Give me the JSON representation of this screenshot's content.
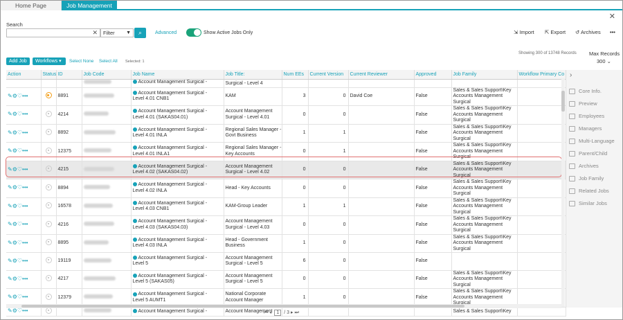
{
  "tabs": [
    {
      "label": "Home Page"
    },
    {
      "label": "Job Management"
    }
  ],
  "search": {
    "label": "Search",
    "value": "",
    "filter": "Filter",
    "advanced": "Advanced",
    "toggle_label": "Show Active Jobs Only"
  },
  "toolbar": {
    "import": "Import",
    "export": "Export",
    "archives": "Archives",
    "add_job": "Add Job",
    "workflows": "Workflows",
    "select_none": "Select None",
    "select_all": "Select All",
    "selected": "Selected: 1",
    "showing": "Showing 300 of 13748 Records",
    "max_records_label": "Max Records",
    "max_records_value": "300"
  },
  "columns": [
    "Action",
    "Status",
    "ID",
    "Job Code",
    "Job Name",
    "Job Title:",
    "Num EEs",
    "Current Version",
    "Current Reviewer",
    "Approved",
    "Job Family",
    "Workflow Primary Co"
  ],
  "top_partial": {
    "job_name": "Account Management Surgical -",
    "job_title": "Surgical - Level 4"
  },
  "rows": [
    {
      "id": "8891",
      "status": "orange",
      "name1": "Account Management Surgical -",
      "name2": "Level 4.01  CNB1",
      "title": "KAM",
      "ees": "3",
      "ver": "0",
      "reviewer": "David Coe",
      "approved": "False",
      "family": "Sales & Sales Support\\Key Accounts Management Surgical"
    },
    {
      "id": "4214",
      "status": "grey",
      "name1": "Account Management Surgical -",
      "name2": "Level 4.01 (SAKAS04.01)",
      "title": "Account Management Surgical - Level 4.01",
      "ees": "0",
      "ver": "0",
      "reviewer": "",
      "approved": "False",
      "family": "Sales & Sales Support\\Key Accounts Management Surgical"
    },
    {
      "id": "8892",
      "status": "grey",
      "name1": "Account Management Surgical -",
      "name2": "Level 4.01 INLA",
      "title": "Regional Sales Manager - Govt Business",
      "ees": "1",
      "ver": "1",
      "reviewer": "",
      "approved": "False",
      "family": "Sales & Sales Support\\Key Accounts Management Surgical"
    },
    {
      "id": "12375",
      "status": "grey",
      "name1": "Account Management Surgical -",
      "name2": "Level 4.01 INLA1",
      "title": "Regional Sales Manager - Key Accounts",
      "ees": "0",
      "ver": "1",
      "reviewer": "",
      "approved": "False",
      "family": "Sales & Sales Support\\Key Accounts Management Surgical"
    },
    {
      "id": "4215",
      "status": "grey",
      "name1": "Account Management Surgical -",
      "name2": "Level 4.02 (SAKAS04.02)",
      "title": "Account Management Surgical - Level 4.02",
      "ees": "0",
      "ver": "0",
      "reviewer": "",
      "approved": "False",
      "family": "Sales & Sales Support\\Key Accounts Management Surgical"
    },
    {
      "id": "8894",
      "status": "grey",
      "name1": "Account Management Surgical -",
      "name2": "Level 4.02 INLA",
      "title": "Head - Key Accounts",
      "ees": "0",
      "ver": "0",
      "reviewer": "",
      "approved": "False",
      "family": "Sales & Sales Support\\Key Accounts Management Surgical"
    },
    {
      "id": "16578",
      "status": "grey",
      "name1": "Account Management Surgical -",
      "name2": "Level 4.03  CNB1",
      "title": "KAM-Group Leader",
      "ees": "1",
      "ver": "1",
      "reviewer": "",
      "approved": "False",
      "family": "Sales & Sales Support\\Key Accounts Management Surgical"
    },
    {
      "id": "4216",
      "status": "grey",
      "name1": "Account Management Surgical -",
      "name2": "Level 4.03 (SAKAS04.03)",
      "title": "Account Management Surgical - Level 4.03",
      "ees": "0",
      "ver": "0",
      "reviewer": "",
      "approved": "False",
      "family": "Sales & Sales Support\\Key Accounts Management Surgical"
    },
    {
      "id": "8895",
      "status": "grey",
      "name1": "Account Management Surgical -",
      "name2": "Level 4.03 INLA",
      "title": "Head - Government Business",
      "ees": "1",
      "ver": "0",
      "reviewer": "",
      "approved": "False",
      "family": "Sales & Sales Support\\Key Accounts Management Surgical"
    },
    {
      "id": "19119",
      "status": "grey",
      "name1": "Account Management Surgical -",
      "name2": "Level 5",
      "title": "Account Management Surgical - Level 5",
      "ees": "6",
      "ver": "0",
      "reviewer": "",
      "approved": "False",
      "family": ""
    },
    {
      "id": "4217",
      "status": "grey",
      "name1": "Account Management Surgical -",
      "name2": "Level 5 (SAKAS05)",
      "title": "Account Management Surgical - Level 5",
      "ees": "0",
      "ver": "0",
      "reviewer": "",
      "approved": "False",
      "family": "Sales & Sales Support\\Key Accounts Management Surgical"
    },
    {
      "id": "12379",
      "status": "grey",
      "name1": "Account Management Surgical -",
      "name2": "Level 5 AUMT1",
      "title": "National Corporate Account Manager",
      "ees": "1",
      "ver": "0",
      "reviewer": "",
      "approved": "False",
      "family": "Sales & Sales Support\\Key Accounts Management Surgical"
    }
  ],
  "bottom_partial": {
    "job_name": "Account Management Surgical -",
    "job_title": "Account Management",
    "family": "Sales & Sales Support\\Key"
  },
  "sidebar": [
    "Core Info.",
    "Preview",
    "Employees",
    "Managers",
    "Multi-Language",
    "Parent/Child",
    "Archives",
    "Job Family",
    "Related Jobs",
    "Similar Jobs"
  ],
  "pager": {
    "page": "1",
    "total": "/ 3"
  }
}
